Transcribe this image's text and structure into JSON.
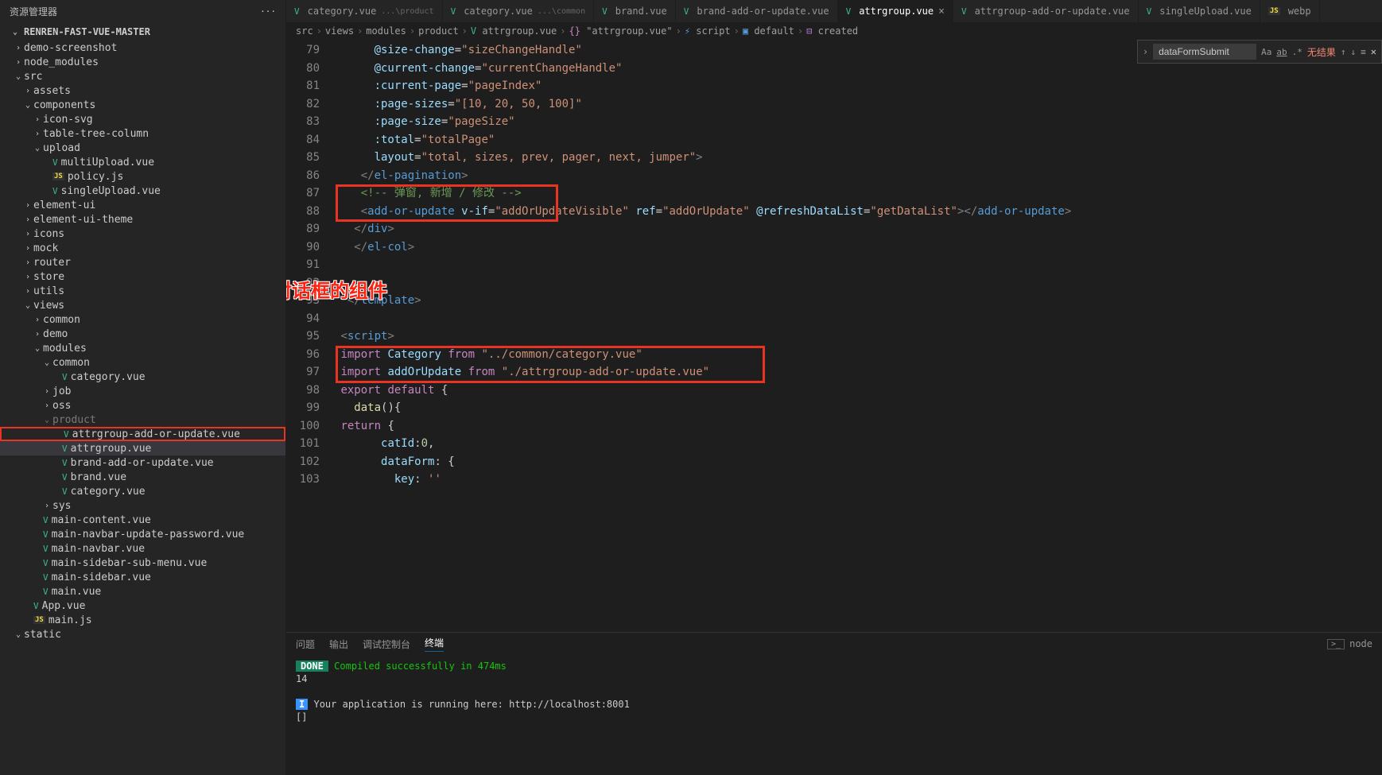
{
  "sidebar": {
    "title": "资源管理器",
    "root": "RENREN-FAST-VUE-MASTER",
    "tree": [
      {
        "indent": 1,
        "chev": "›",
        "label": "demo-screenshot"
      },
      {
        "indent": 1,
        "chev": "›",
        "label": "node_modules"
      },
      {
        "indent": 1,
        "chev": "⌄",
        "label": "src"
      },
      {
        "indent": 2,
        "chev": "›",
        "label": "assets"
      },
      {
        "indent": 2,
        "chev": "⌄",
        "label": "components"
      },
      {
        "indent": 3,
        "chev": "›",
        "label": "icon-svg"
      },
      {
        "indent": 3,
        "chev": "›",
        "label": "table-tree-column"
      },
      {
        "indent": 3,
        "chev": "⌄",
        "label": "upload"
      },
      {
        "indent": 4,
        "icon": "vue",
        "label": "multiUpload.vue"
      },
      {
        "indent": 4,
        "icon": "js",
        "label": "policy.js"
      },
      {
        "indent": 4,
        "icon": "vue",
        "label": "singleUpload.vue"
      },
      {
        "indent": 2,
        "chev": "›",
        "label": "element-ui"
      },
      {
        "indent": 2,
        "chev": "›",
        "label": "element-ui-theme"
      },
      {
        "indent": 2,
        "chev": "›",
        "label": "icons"
      },
      {
        "indent": 2,
        "chev": "›",
        "label": "mock"
      },
      {
        "indent": 2,
        "chev": "›",
        "label": "router"
      },
      {
        "indent": 2,
        "chev": "›",
        "label": "store"
      },
      {
        "indent": 2,
        "chev": "›",
        "label": "utils"
      },
      {
        "indent": 2,
        "chev": "⌄",
        "label": "views"
      },
      {
        "indent": 3,
        "chev": "›",
        "label": "common"
      },
      {
        "indent": 3,
        "chev": "›",
        "label": "demo"
      },
      {
        "indent": 3,
        "chev": "⌄",
        "label": "modules"
      },
      {
        "indent": 4,
        "chev": "⌄",
        "label": "common"
      },
      {
        "indent": 5,
        "icon": "vue",
        "label": "category.vue"
      },
      {
        "indent": 4,
        "chev": "›",
        "label": "job"
      },
      {
        "indent": 4,
        "chev": "›",
        "label": "oss"
      },
      {
        "indent": 4,
        "chev": "⌄",
        "label": "product",
        "dimmed": true
      },
      {
        "indent": 5,
        "icon": "vue",
        "label": "attrgroup-add-or-update.vue",
        "hl": true
      },
      {
        "indent": 5,
        "icon": "vue",
        "label": "attrgroup.vue",
        "selected": true
      },
      {
        "indent": 5,
        "icon": "vue",
        "label": "brand-add-or-update.vue"
      },
      {
        "indent": 5,
        "icon": "vue",
        "label": "brand.vue"
      },
      {
        "indent": 5,
        "icon": "vue",
        "label": "category.vue"
      },
      {
        "indent": 4,
        "chev": "›",
        "label": "sys"
      },
      {
        "indent": 3,
        "icon": "vue",
        "label": "main-content.vue"
      },
      {
        "indent": 3,
        "icon": "vue",
        "label": "main-navbar-update-password.vue"
      },
      {
        "indent": 3,
        "icon": "vue",
        "label": "main-navbar.vue"
      },
      {
        "indent": 3,
        "icon": "vue",
        "label": "main-sidebar-sub-menu.vue"
      },
      {
        "indent": 3,
        "icon": "vue",
        "label": "main-sidebar.vue"
      },
      {
        "indent": 3,
        "icon": "vue",
        "label": "main.vue"
      },
      {
        "indent": 2,
        "icon": "vue",
        "label": "App.vue"
      },
      {
        "indent": 2,
        "icon": "js",
        "label": "main.js"
      },
      {
        "indent": 1,
        "chev": "⌄",
        "label": "static"
      }
    ]
  },
  "tabs": [
    {
      "icon": "vue",
      "label": "category.vue",
      "path": "...\\product"
    },
    {
      "icon": "vue",
      "label": "category.vue",
      "path": "...\\common"
    },
    {
      "icon": "vue",
      "label": "brand.vue"
    },
    {
      "icon": "vue",
      "label": "brand-add-or-update.vue"
    },
    {
      "icon": "vue",
      "label": "attrgroup.vue",
      "active": true,
      "close": true
    },
    {
      "icon": "vue",
      "label": "attrgroup-add-or-update.vue"
    },
    {
      "icon": "vue",
      "label": "singleUpload.vue"
    },
    {
      "icon": "js",
      "label": "webp"
    }
  ],
  "breadcrumbs": [
    "src",
    "views",
    "modules",
    "product",
    "attrgroup.vue",
    "{} \"attrgroup.vue\"",
    "script",
    "default",
    "created"
  ],
  "search": {
    "value": "dataFormSubmit",
    "opt_case": "Aa",
    "opt_word": "ab",
    "opt_regex": ".*",
    "no_results": "无结果"
  },
  "gutter": [
    "79",
    "80",
    "81",
    "82",
    "83",
    "84",
    "85",
    "86",
    "87",
    "88",
    "89",
    "90",
    "91",
    "92",
    "93",
    "94",
    "95",
    "96",
    "97",
    "98",
    "99",
    "100",
    "101",
    "102",
    "103"
  ],
  "annotation": "添加对话框的组件",
  "terminal": {
    "tabs": [
      "问题",
      "输出",
      "调试控制台",
      "终端"
    ],
    "active_tab": "终端",
    "node_label": "node",
    "done": "DONE",
    "compiled": "Compiled successfully in 474ms",
    "line2": "14",
    "info": "I",
    "running": "Your application is running here: http://localhost:8001",
    "cursor": "[]"
  }
}
